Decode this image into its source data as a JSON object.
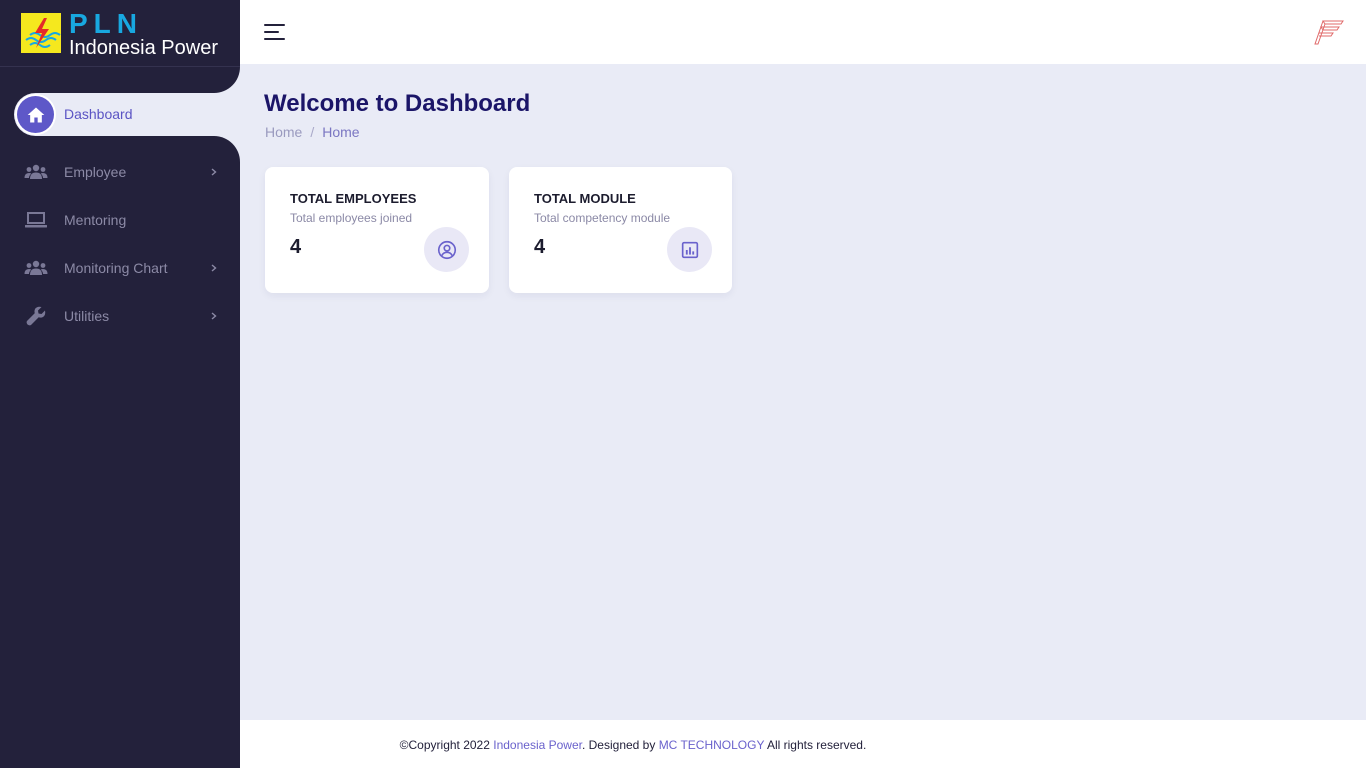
{
  "brand": {
    "name": "PLN",
    "subtitle": "Indonesia Power"
  },
  "sidebar": {
    "items": [
      {
        "label": "Dashboard",
        "icon": "home-icon",
        "active": true
      },
      {
        "label": "Employee",
        "icon": "users-icon",
        "has_children": true
      },
      {
        "label": "Mentoring",
        "icon": "laptop-icon",
        "has_children": false
      },
      {
        "label": "Monitoring Chart",
        "icon": "users-icon",
        "has_children": true
      },
      {
        "label": "Utilities",
        "icon": "wrench-icon",
        "has_children": true
      }
    ]
  },
  "header": {
    "menu_icon": "hamburger-icon",
    "logo_icon": "brand-mark-icon"
  },
  "main": {
    "title": "Welcome to Dashboard",
    "breadcrumb": [
      "Home",
      "Home"
    ],
    "cards": [
      {
        "title": "TOTAL EMPLOYEES",
        "subtitle": "Total employees joined",
        "value": "4",
        "icon": "user-circle-icon"
      },
      {
        "title": "TOTAL MODULE",
        "subtitle": "Total competency module",
        "value": "4",
        "icon": "bar-chart-icon"
      }
    ]
  },
  "footer": {
    "prefix": "©Copyright 2022 ",
    "company": "Indonesia Power",
    "middle": ". Designed by ",
    "designer": "MC TECHNOLOGY",
    "suffix": " All rights reserved."
  },
  "colors": {
    "sidebar_bg": "#23213b",
    "accent": "#5e58c8",
    "page_bg": "#e9ebf6",
    "title": "#1b1568",
    "brand_blue": "#18a8e0",
    "brand_yellow": "#f5e81e"
  }
}
